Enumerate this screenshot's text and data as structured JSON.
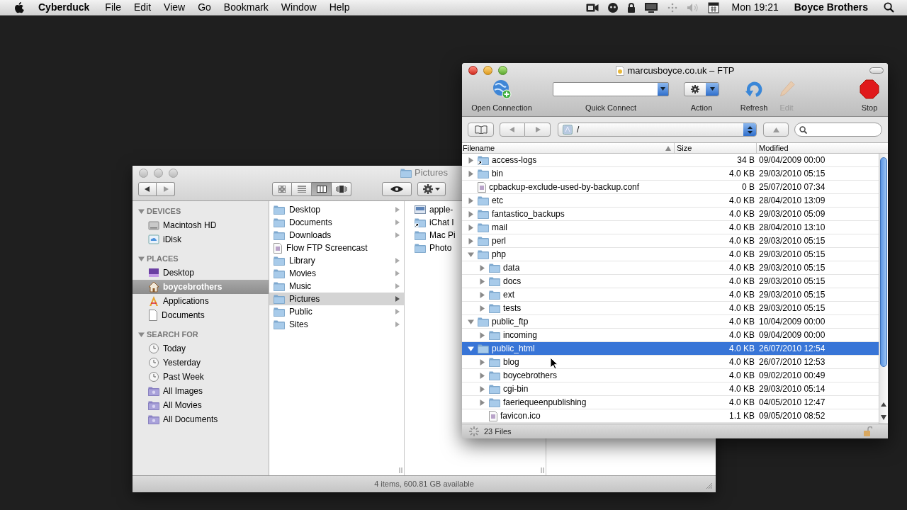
{
  "menubar": {
    "app": "Cyberduck",
    "menus": [
      "File",
      "Edit",
      "View",
      "Go",
      "Bookmark",
      "Window",
      "Help"
    ],
    "clock": "Mon 19:21",
    "user": "Boyce Brothers"
  },
  "finder": {
    "title": "Pictures",
    "view_buttons": [
      {
        "kind": "icons",
        "selected": false
      },
      {
        "kind": "list",
        "selected": false
      },
      {
        "kind": "columns",
        "selected": true
      },
      {
        "kind": "coverflow",
        "selected": false
      }
    ],
    "sidebar": [
      {
        "heading": "DEVICES",
        "expanded": true,
        "items": [
          {
            "label": "Macintosh HD",
            "kind": "drive",
            "selected": false
          },
          {
            "label": "iDisk",
            "kind": "idisk",
            "selected": false
          }
        ]
      },
      {
        "heading": "PLACES",
        "expanded": true,
        "items": [
          {
            "label": "Desktop",
            "kind": "desktop",
            "selected": false
          },
          {
            "label": "boycebrothers",
            "kind": "home",
            "selected": true
          },
          {
            "label": "Applications",
            "kind": "apps",
            "selected": false
          },
          {
            "label": "Documents",
            "kind": "document",
            "selected": false
          }
        ]
      },
      {
        "heading": "SEARCH FOR",
        "expanded": true,
        "items": [
          {
            "label": "Today",
            "kind": "clock",
            "selected": false
          },
          {
            "label": "Yesterday",
            "kind": "clock",
            "selected": false
          },
          {
            "label": "Past Week",
            "kind": "clock",
            "selected": false
          },
          {
            "label": "All Images",
            "kind": "smart",
            "selected": false
          },
          {
            "label": "All Movies",
            "kind": "smart",
            "selected": false
          },
          {
            "label": "All Documents",
            "kind": "smart",
            "selected": false
          }
        ]
      }
    ],
    "column_1": [
      {
        "label": "Desktop",
        "kind": "folder",
        "has_children": true,
        "selected": false
      },
      {
        "label": "Documents",
        "kind": "folder",
        "has_children": true,
        "selected": false
      },
      {
        "label": "Downloads",
        "kind": "folder",
        "has_children": true,
        "selected": false
      },
      {
        "label": "Flow FTP Screencast",
        "kind": "file",
        "has_children": false,
        "selected": false
      },
      {
        "label": "Library",
        "kind": "folder",
        "has_children": true,
        "selected": false
      },
      {
        "label": "Movies",
        "kind": "folder",
        "has_children": true,
        "selected": false
      },
      {
        "label": "Music",
        "kind": "folder",
        "has_children": true,
        "selected": false
      },
      {
        "label": "Pictures",
        "kind": "folder",
        "has_children": true,
        "selected": true
      },
      {
        "label": "Public",
        "kind": "folder",
        "has_children": true,
        "selected": false
      },
      {
        "label": "Sites",
        "kind": "folder",
        "has_children": true,
        "selected": false
      }
    ],
    "column_2": [
      {
        "label": "apple-",
        "kind": "file"
      },
      {
        "label": "iChat I",
        "kind": "link"
      },
      {
        "label": "Mac Pi",
        "kind": "folder"
      },
      {
        "label": "Photo",
        "kind": "folder"
      }
    ],
    "status": "4 items, 600.81 GB available"
  },
  "ftp": {
    "title": "marcusboyce.co.uk – FTP",
    "toolbar": [
      {
        "kind": "open",
        "label": "Open Connection",
        "disabled": false
      },
      {
        "kind": "quick",
        "label": "Quick Connect",
        "disabled": false
      },
      {
        "kind": "action",
        "label": "Action",
        "disabled": false
      },
      {
        "kind": "refresh",
        "label": "Refresh",
        "disabled": false
      },
      {
        "kind": "edit",
        "label": "Edit",
        "disabled": true
      },
      {
        "kind": "stop",
        "label": "Stop",
        "disabled": false
      }
    ],
    "path": "/",
    "columns": [
      "Filename",
      "Size",
      "Modified"
    ],
    "rows": [
      {
        "name": "access-logs",
        "kind": "link",
        "size": "34 B",
        "modified": "09/04/2009 00:00",
        "expanded": false,
        "selected": false
      },
      {
        "name": "bin",
        "kind": "folder",
        "size": "4.0 KB",
        "modified": "29/03/2010 05:15",
        "expanded": false,
        "selected": false
      },
      {
        "name": "cpbackup-exclude-used-by-backup.conf",
        "kind": "file",
        "size": "0 B",
        "modified": "25/07/2010 07:34",
        "selected": false
      },
      {
        "name": "etc",
        "kind": "folder",
        "size": "4.0 KB",
        "modified": "28/04/2010 13:09",
        "expanded": false,
        "selected": false
      },
      {
        "name": "fantastico_backups",
        "kind": "folder",
        "size": "4.0 KB",
        "modified": "29/03/2010 05:09",
        "expanded": false,
        "selected": false
      },
      {
        "name": "mail",
        "kind": "folder",
        "size": "4.0 KB",
        "modified": "28/04/2010 13:10",
        "expanded": false,
        "selected": false
      },
      {
        "name": "perl",
        "kind": "folder",
        "size": "4.0 KB",
        "modified": "29/03/2010 05:15",
        "expanded": false,
        "selected": false
      },
      {
        "name": "php",
        "kind": "folder",
        "size": "4.0 KB",
        "modified": "29/03/2010 05:15",
        "expanded": true,
        "selected": false,
        "children": [
          {
            "name": "data",
            "kind": "folder",
            "size": "4.0 KB",
            "modified": "29/03/2010 05:15",
            "expanded": false,
            "selected": false
          },
          {
            "name": "docs",
            "kind": "folder",
            "size": "4.0 KB",
            "modified": "29/03/2010 05:15",
            "expanded": false,
            "selected": false
          },
          {
            "name": "ext",
            "kind": "folder",
            "size": "4.0 KB",
            "modified": "29/03/2010 05:15",
            "expanded": false,
            "selected": false
          },
          {
            "name": "tests",
            "kind": "folder",
            "size": "4.0 KB",
            "modified": "29/03/2010 05:15",
            "expanded": false,
            "selected": false
          }
        ]
      },
      {
        "name": "public_ftp",
        "kind": "folder",
        "size": "4.0 KB",
        "modified": "10/04/2009 00:00",
        "expanded": true,
        "selected": false,
        "children": [
          {
            "name": "incoming",
            "kind": "folder",
            "size": "4.0 KB",
            "modified": "09/04/2009 00:00",
            "expanded": false,
            "selected": false
          }
        ]
      },
      {
        "name": "public_html",
        "kind": "folder",
        "size": "4.0 KB",
        "modified": "26/07/2010 12:54",
        "expanded": true,
        "selected": true,
        "children": [
          {
            "name": "blog",
            "kind": "folder",
            "size": "4.0 KB",
            "modified": "26/07/2010 12:53",
            "expanded": false,
            "selected": false
          },
          {
            "name": "boycebrothers",
            "kind": "folder",
            "size": "4.0 KB",
            "modified": "09/02/2010 00:49",
            "expanded": false,
            "selected": false
          },
          {
            "name": "cgi-bin",
            "kind": "folder",
            "size": "4.0 KB",
            "modified": "29/03/2010 05:14",
            "expanded": false,
            "selected": false
          },
          {
            "name": "faeriequeenpublishing",
            "kind": "folder",
            "size": "4.0 KB",
            "modified": "04/05/2010 12:47",
            "expanded": false,
            "selected": false
          },
          {
            "name": "favicon.ico",
            "kind": "file",
            "size": "1.1 KB",
            "modified": "09/05/2010 08:52",
            "selected": false
          }
        ]
      }
    ],
    "status": "23 Files"
  }
}
